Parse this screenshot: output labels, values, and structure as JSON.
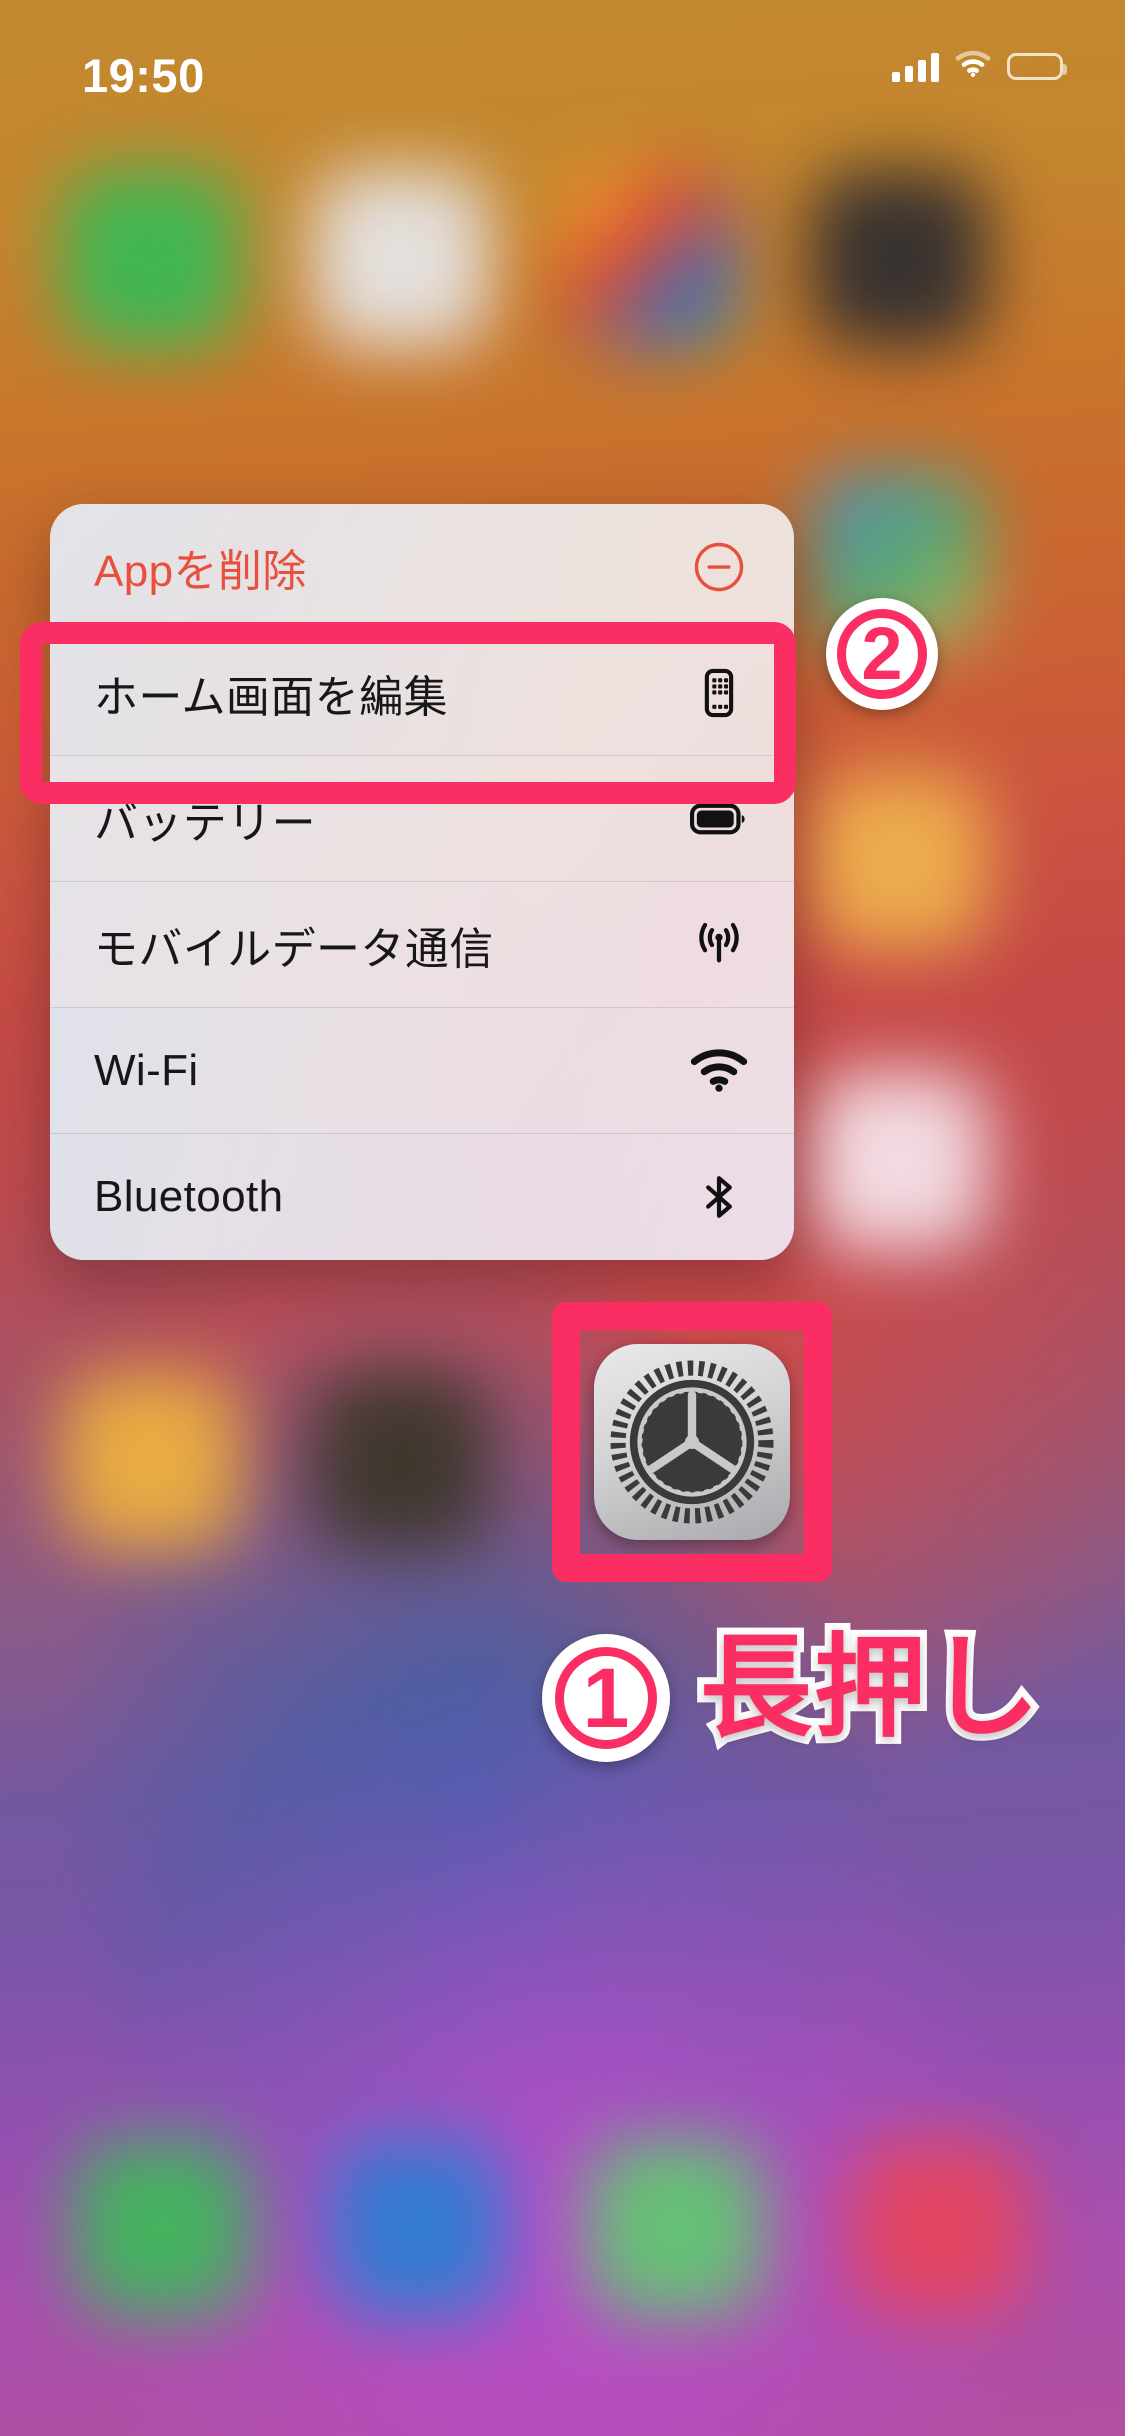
{
  "status_bar": {
    "time": "19:50",
    "signal_icon": "cellular-signal-icon",
    "wifi_icon": "wifi-icon",
    "battery_icon": "battery-icon"
  },
  "context_menu": {
    "items": [
      {
        "label": "Appを削除",
        "icon": "minus-circle-icon",
        "destructive": true,
        "highlighted": false
      },
      {
        "label": "ホーム画面を編集",
        "icon": "edit-home-screen-icon",
        "destructive": false,
        "highlighted": true
      },
      {
        "label": "バッテリー",
        "icon": "battery-icon",
        "destructive": false,
        "highlighted": false
      },
      {
        "label": "モバイルデータ通信",
        "icon": "cellular-data-icon",
        "destructive": false,
        "highlighted": false
      },
      {
        "label": "Wi-Fi",
        "icon": "wifi-icon",
        "destructive": false,
        "highlighted": false
      },
      {
        "label": "Bluetooth",
        "icon": "bluetooth-icon",
        "destructive": false,
        "highlighted": false
      }
    ]
  },
  "annotations": {
    "step_two_badge": "2",
    "step_one_badge": "1",
    "step_one_text": "長押し"
  },
  "app_icon": {
    "name": "settings-app-icon"
  },
  "colors": {
    "highlight_pink": "#fb2e63",
    "destructive_red": "#e8503c",
    "menu_text": "#17171a",
    "status_text": "#ffffff"
  }
}
